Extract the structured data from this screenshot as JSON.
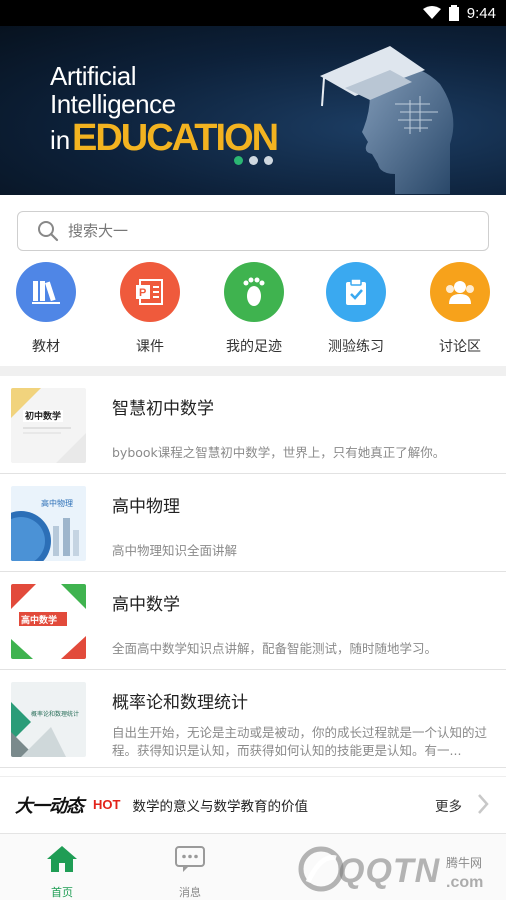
{
  "status_bar": {
    "time": "9:44"
  },
  "banner": {
    "line1": "Artificial",
    "line2": "Intelligence",
    "line3": "in",
    "line4": "EDUCATION"
  },
  "search": {
    "placeholder": "搜索大一"
  },
  "quick_links": [
    {
      "label": "教材",
      "icon": "books-icon",
      "color": "#4f86e6"
    },
    {
      "label": "课件",
      "icon": "slides-icon",
      "color": "#ef5a3c"
    },
    {
      "label": "我的足迹",
      "icon": "footprint-icon",
      "color": "#3fb34f"
    },
    {
      "label": "测验练习",
      "icon": "quiz-clipboard-icon",
      "color": "#3aa9f0"
    },
    {
      "label": "讨论区",
      "icon": "discussion-icon",
      "color": "#f7a21b"
    }
  ],
  "courses": [
    {
      "title": "智慧初中数学",
      "desc": "bybook课程之智慧初中数学，世界上，只有她真正了解你。",
      "thumb_text": "初中数学"
    },
    {
      "title": "高中物理",
      "desc": "高中物理知识全面讲解",
      "thumb_text": "高中物理"
    },
    {
      "title": "高中数学",
      "desc": "全面高中数学知识点讲解，配备智能测试，随时随地学习。",
      "thumb_text": "高中数学"
    },
    {
      "title": "概率论和数理统计",
      "desc": "自出生开始，无论是主动或是被动，你的成长过程就是一个认知的过程。获得知识是认知，而获得如何认知的技能更是认知。有一...",
      "thumb_text": "概率论和数理统计"
    }
  ],
  "news": {
    "brand": "大一动态",
    "badge": "HOT",
    "headline": "数学的意义与数学教育的价值",
    "more": "更多"
  },
  "tabs": [
    {
      "label": "首页",
      "icon": "home-icon"
    },
    {
      "label": "消息",
      "icon": "message-icon"
    }
  ],
  "watermark": {
    "text": "QQTN",
    "suffix": ".com",
    "small": "腾牛网"
  },
  "colors": {
    "accent": "#1f9d55",
    "hot": "#e2231a",
    "banner_bg": "#0d213a",
    "education": "#f3b320"
  }
}
